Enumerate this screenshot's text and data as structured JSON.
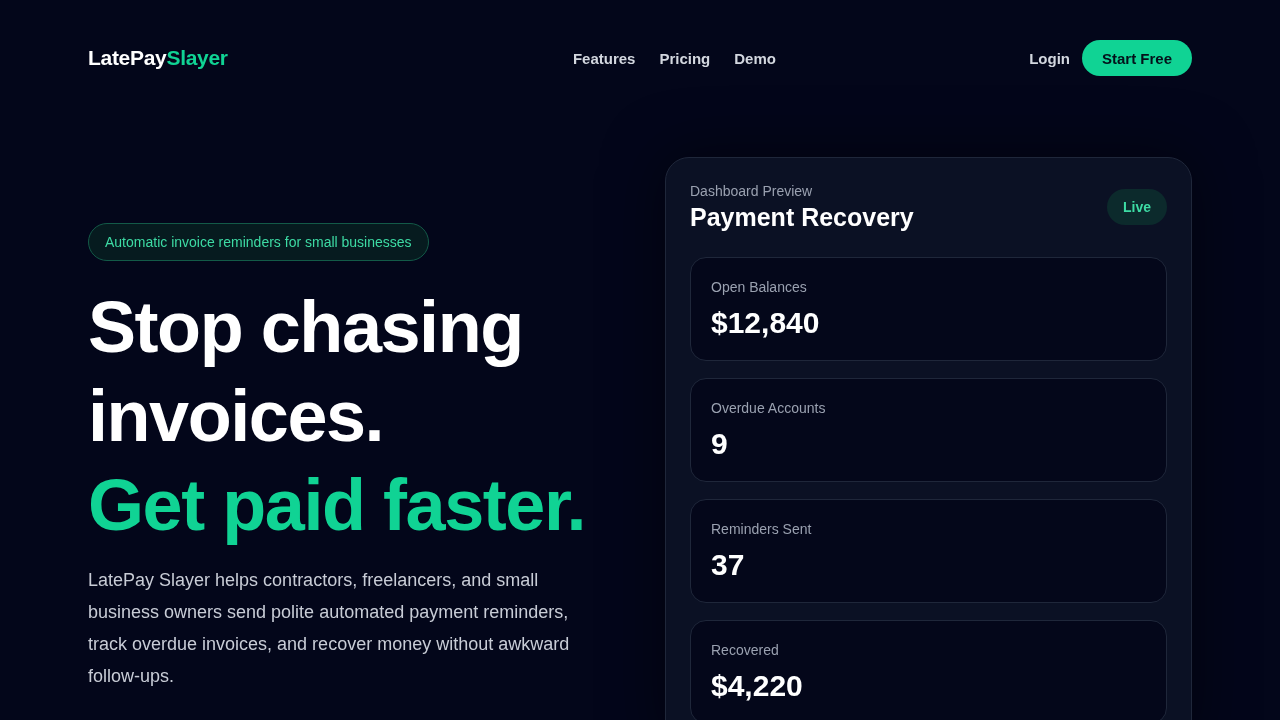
{
  "header": {
    "logo": {
      "primary": "LatePay",
      "accent": "Slayer"
    },
    "nav": [
      "Features",
      "Pricing",
      "Demo"
    ],
    "login": "Login",
    "cta": "Start Free"
  },
  "hero": {
    "badge": "Automatic invoice reminders for small businesses",
    "headline": "Stop chasing invoices.",
    "headline_accent": "Get paid faster.",
    "description": "LatePay Slayer helps contractors, freelancers, and small business owners send polite automated payment reminders, track overdue invoices, and recover money without awkward follow-ups."
  },
  "preview": {
    "eyebrow": "Dashboard Preview",
    "title": "Payment Recovery",
    "status": "Live",
    "stats": [
      {
        "label": "Open Balances",
        "value": "$12,840"
      },
      {
        "label": "Overdue Accounts",
        "value": "9"
      },
      {
        "label": "Reminders Sent",
        "value": "37"
      },
      {
        "label": "Recovered",
        "value": "$4,220"
      }
    ]
  }
}
